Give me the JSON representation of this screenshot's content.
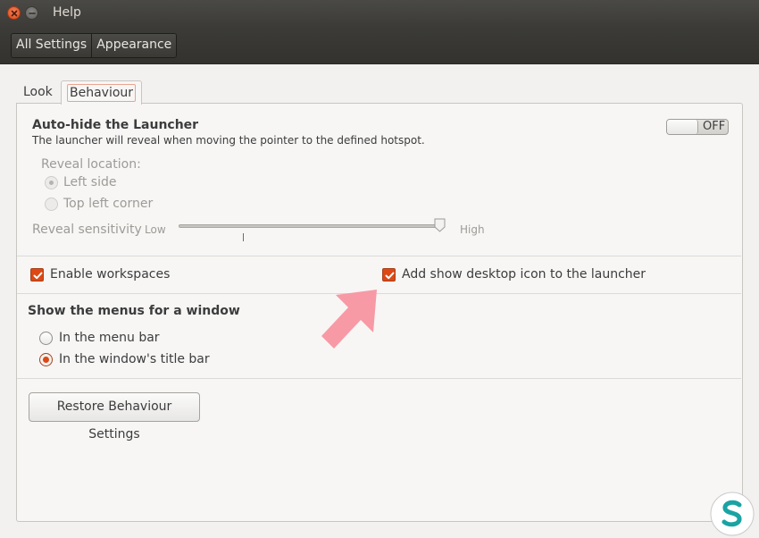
{
  "window": {
    "title": "Help"
  },
  "toolbar": {
    "breadcrumbs": [
      "All Settings",
      "Appearance"
    ]
  },
  "tabs": {
    "look": "Look",
    "behaviour": "Behaviour",
    "active": "Behaviour"
  },
  "autohide": {
    "title": "Auto-hide the Launcher",
    "description": "The launcher will reveal when moving the pointer to the defined hotspot.",
    "toggle_label": "OFF",
    "toggle_state": false,
    "reveal_location_label": "Reveal location:",
    "options": [
      "Left side",
      "Top left corner"
    ],
    "selected_option": "Left side",
    "sensitivity_label": "Reveal sensitivity",
    "sensitivity_low": "Low",
    "sensitivity_high": "High",
    "sensitivity_value": 1.0
  },
  "checks": {
    "workspaces_label": "Enable workspaces",
    "workspaces_checked": true,
    "desktop_icon_label": "Add show desktop icon to the launcher",
    "desktop_icon_checked": true
  },
  "menus": {
    "title": "Show the menus for a window",
    "options": [
      "In the menu bar",
      "In the window's title bar"
    ],
    "selected": "In the window's title bar"
  },
  "restore_button": "Restore Behaviour Settings",
  "colors": {
    "accent": "#dd4814",
    "arrow": "#f79aa5",
    "titlebar": "#3c3b37"
  },
  "icons": [
    "close-icon",
    "minimize-icon",
    "checkmark-icon",
    "arrow-pointer-icon",
    "site-logo-icon"
  ]
}
